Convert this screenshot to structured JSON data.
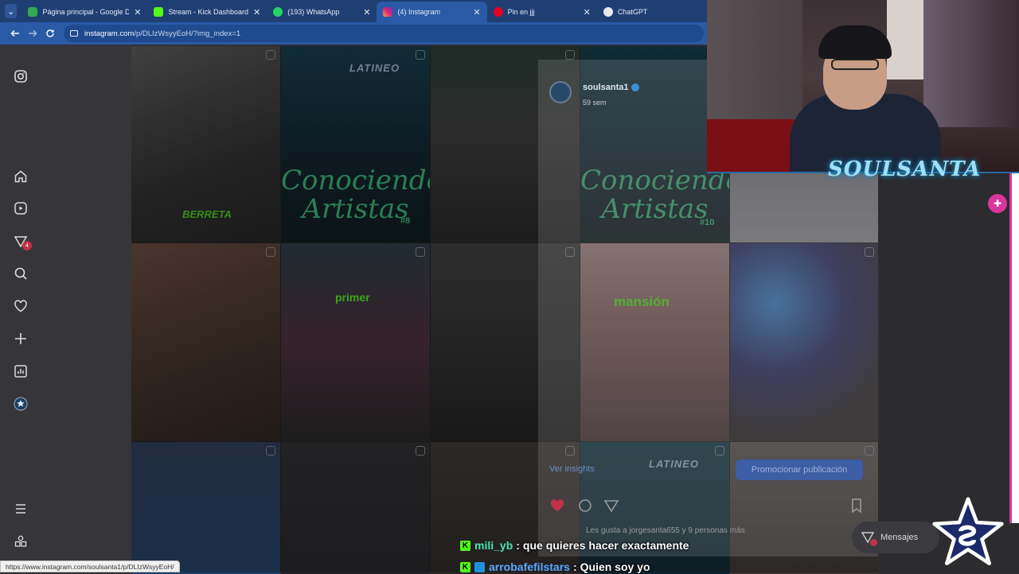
{
  "browser": {
    "tabs": [
      {
        "title": "Página principal - Google Drive",
        "favicon_color": "#34a853",
        "active": false
      },
      {
        "title": "Stream - Kick Dashboard",
        "favicon_color": "#53fc18",
        "active": false
      },
      {
        "title": "(193) WhatsApp",
        "favicon_color": "#25d366",
        "active": false
      },
      {
        "title": "(4) Instagram",
        "favicon_color": "#d62976",
        "active": true
      },
      {
        "title": "Pin en jjj",
        "favicon_color": "#e60023",
        "active": false
      },
      {
        "title": "ChatGPT",
        "favicon_color": "#e8e8e8",
        "active": false
      }
    ],
    "close_glyph": "✕",
    "url_host": "instagram.com",
    "url_path": "/p/DLIzWsyyEoH/?img_index=1",
    "status_url": "https://www.instagram.com/soulsanta1/p/DLIzWsyyEoH/"
  },
  "sidebar": {
    "notification_count": "4",
    "icons": [
      "instagram-icon",
      "home-icon",
      "reels-icon",
      "messages-icon",
      "search-icon",
      "heart-icon",
      "create-icon",
      "dashboard-icon",
      "profile-icon",
      "menu-icon",
      "more-icon"
    ]
  },
  "grid": {
    "captions": {
      "cell1": "BERRETA",
      "cell2_title": "Conociendo",
      "cell2_sub": "Artistas",
      "cell2_num": "#8",
      "cell4_title": "Conociendo",
      "cell4_sub": "Artistas",
      "cell4_num": "#10",
      "cell7": "primer",
      "cell9": "mansión",
      "latineo": "LATINEO"
    }
  },
  "modal": {
    "username": "soulsanta1",
    "subtitle": "59 sem",
    "insights_label": "Ver insights",
    "promote_label": "Promocionar publicación",
    "likes_text": "Les gusta a jorgesanta655 y 9 personas más"
  },
  "messages_pill": {
    "label": "Mensajes"
  },
  "stream_overlay": {
    "brand_text": "SOULSANTA",
    "chat": [
      {
        "user": "mili_yb",
        "separator": ":",
        "message": "que quieres hacer exactamente"
      },
      {
        "user": "arrobafefilstars",
        "separator": ":",
        "message": "Quien soy yo"
      }
    ]
  },
  "colors": {
    "ig_bg": "#303034",
    "kick_green": "#53fc18",
    "chrome_blue": "#2a5aa6",
    "pink_accent": "#d8369a"
  }
}
